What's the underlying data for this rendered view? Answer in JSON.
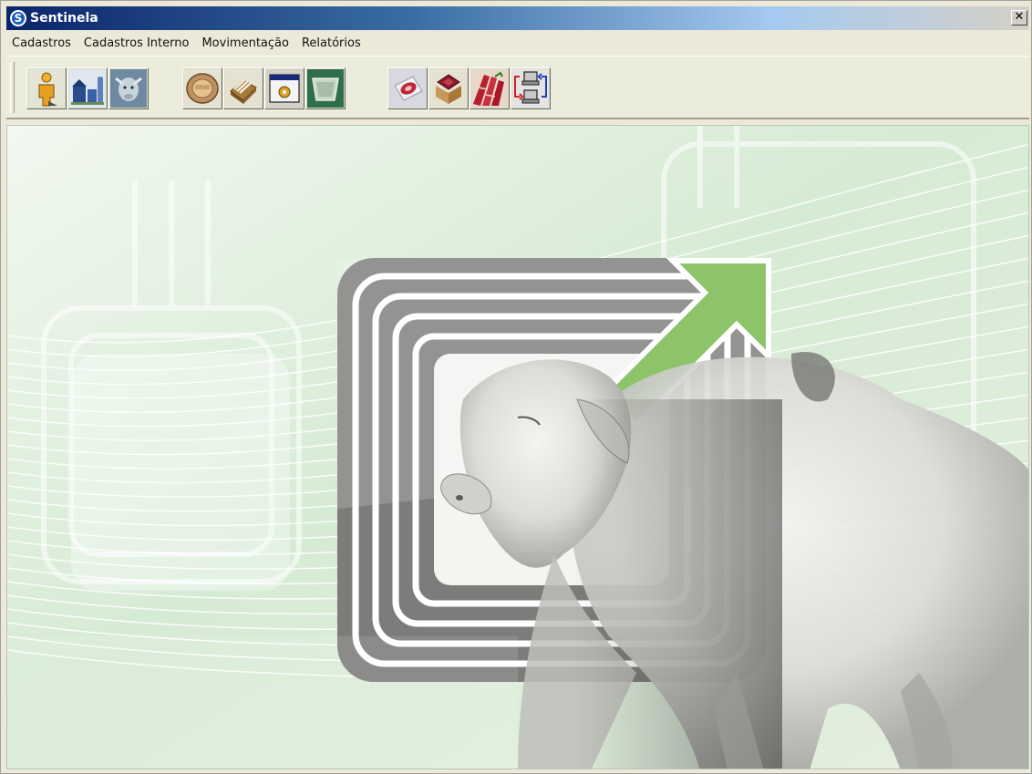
{
  "window": {
    "title": "Sentinela",
    "app_icon_glyph": "S",
    "close_glyph": "✕"
  },
  "menu": {
    "items": [
      {
        "label": "Cadastros"
      },
      {
        "label": "Cadastros Interno"
      },
      {
        "label": "Movimentação"
      },
      {
        "label": "Relatórios"
      }
    ]
  },
  "toolbar": {
    "buttons": [
      {
        "icon": "person-icon"
      },
      {
        "icon": "farm-icon"
      },
      {
        "icon": "cattle-icon"
      },
      {
        "icon": "rfid-tag-icon"
      },
      {
        "icon": "card-box-icon"
      },
      {
        "icon": "settings-window-icon"
      },
      {
        "icon": "tray-icon"
      },
      {
        "icon": "meat-tray-icon"
      },
      {
        "icon": "meat-box-icon"
      },
      {
        "icon": "meat-cuts-icon"
      },
      {
        "icon": "data-sync-icon"
      }
    ]
  },
  "colors": {
    "title_bar_start": "#0a246a",
    "title_bar_end": "#a6caf0",
    "splash_green": "#8dc46a",
    "splash_gray": "#7a7a78",
    "background_green": "#dcefdc"
  }
}
